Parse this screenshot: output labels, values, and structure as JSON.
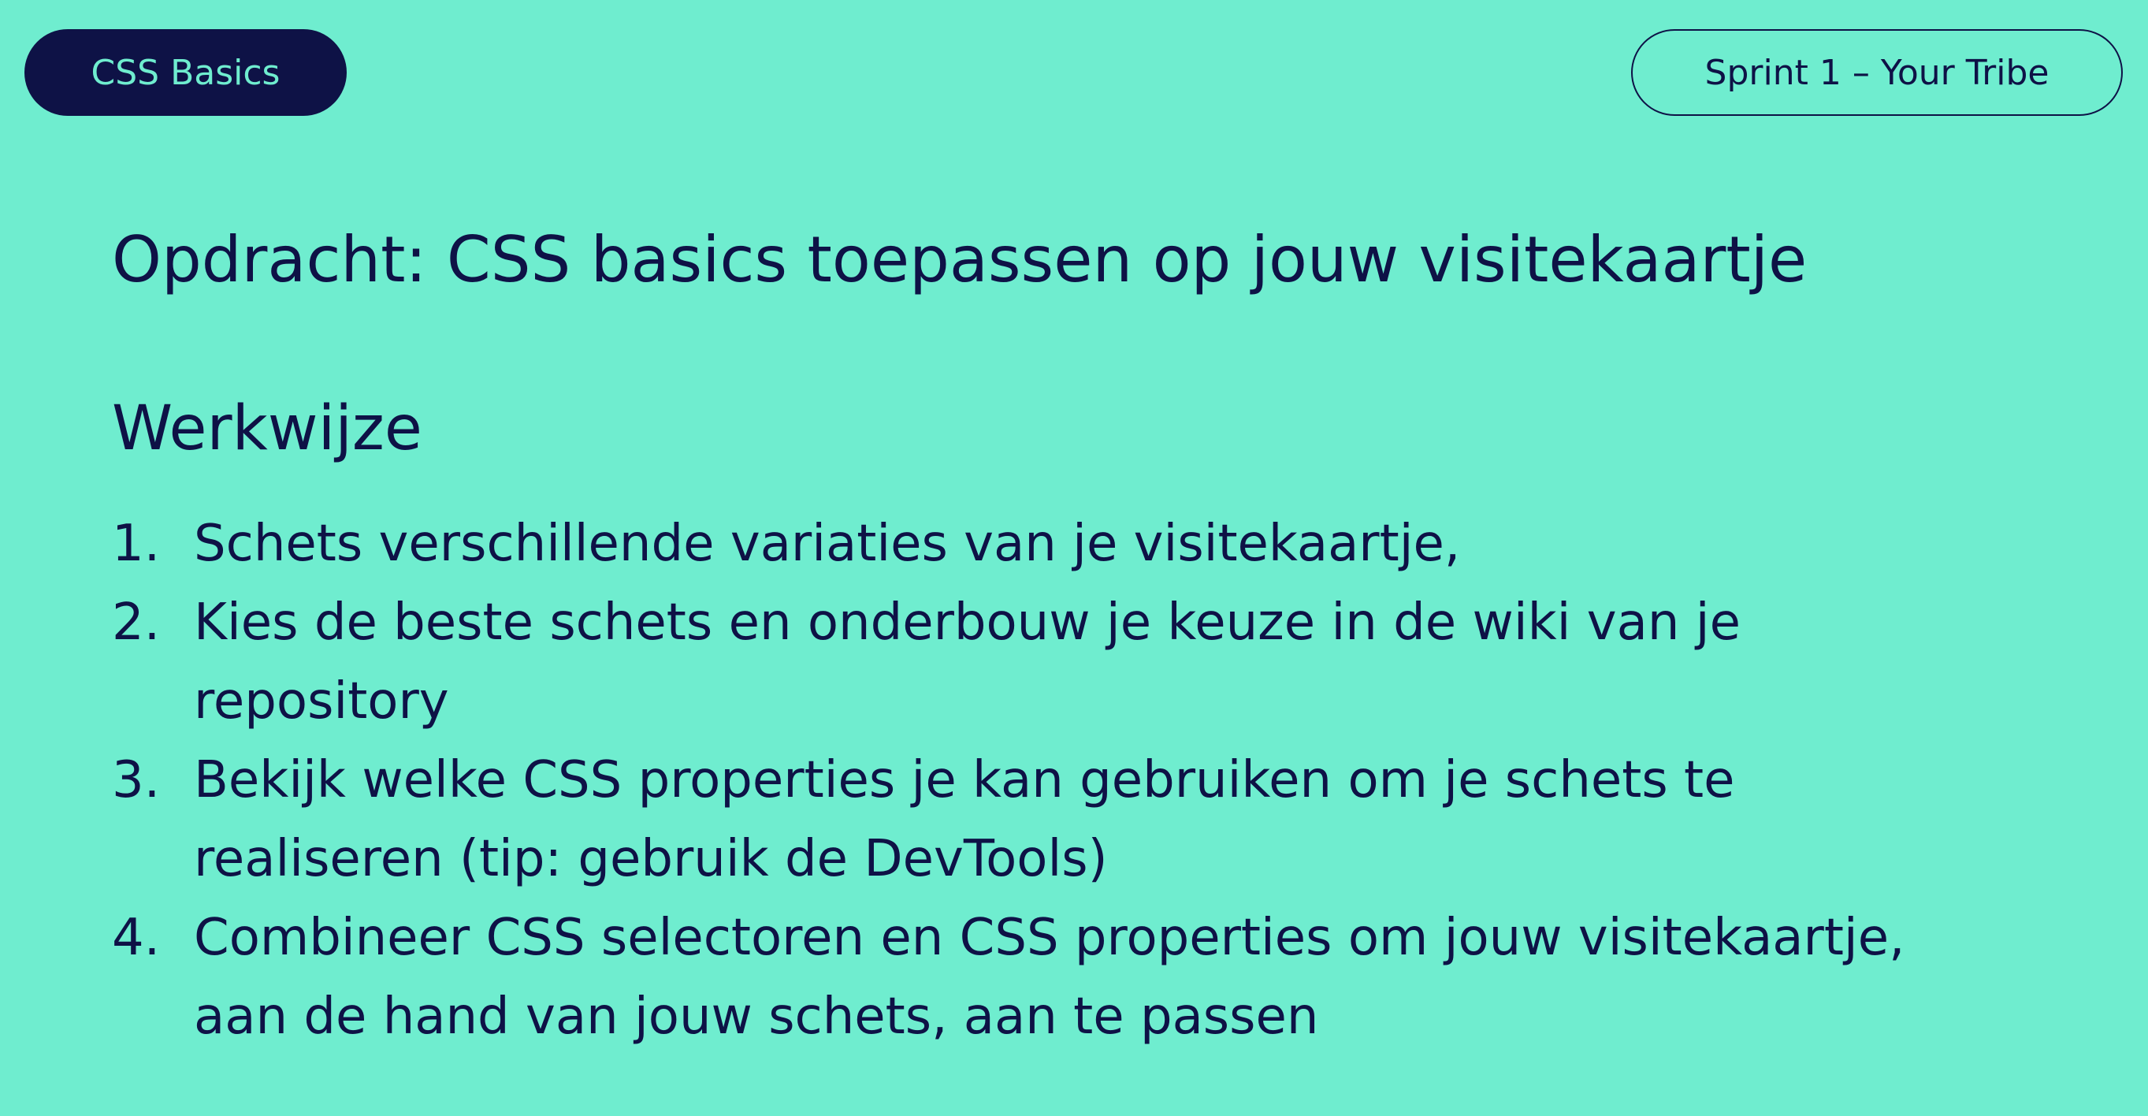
{
  "header": {
    "left_pill": "CSS Basics",
    "right_pill": "Sprint 1 – Your Tribe"
  },
  "main": {
    "title": "Opdracht: CSS basics toepassen op jouw visitekaartje",
    "subtitle": "Werkwijze",
    "steps": [
      {
        "number": "1.",
        "text": "Schets verschillende variaties van je visitekaartje,"
      },
      {
        "number": "2.",
        "text": "Kies de beste schets en onderbouw je keuze in de wiki van je repository"
      },
      {
        "number": "3.",
        "text": "Bekijk welke CSS properties je kan gebruiken om je schets te realiseren (tip: gebruik de DevTools)"
      },
      {
        "number": "4.",
        "text": "Combineer CSS selectoren en CSS properties om jouw visitekaartje, aan de hand van jouw schets, aan te passen"
      }
    ]
  },
  "colors": {
    "background": "#6fedcf",
    "text": "#0e1246"
  }
}
